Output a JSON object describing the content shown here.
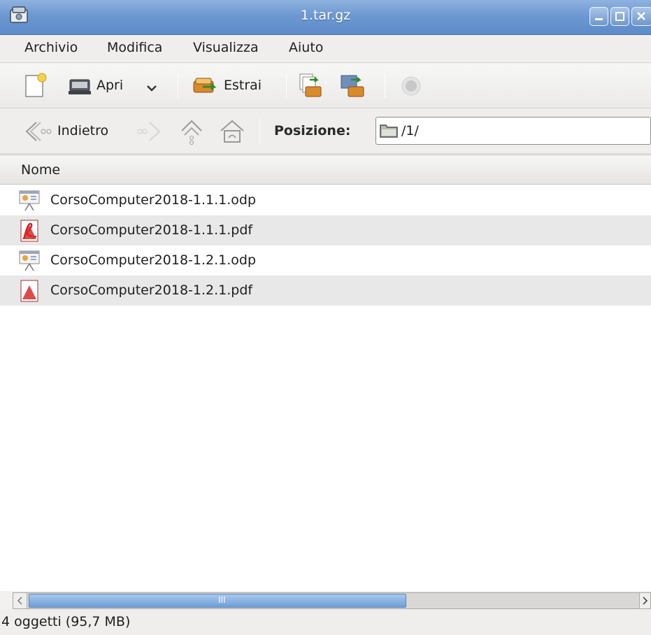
{
  "window": {
    "title": "1.tar.gz",
    "app_icon": "archive-manager-icon"
  },
  "menu": [
    "Archivio",
    "Modifica",
    "Visualizza",
    "Aiuto"
  ],
  "toolbar": {
    "new_icon": "new-archive-icon",
    "open_label": "Apri",
    "extract_label": "Estrai",
    "add_files_icon": "add-files-icon",
    "add_folder_icon": "add-folder-icon",
    "stop_icon": "stop-icon"
  },
  "location": {
    "back_label": "Indietro",
    "location_label": "Posizione:",
    "path": "/1/"
  },
  "list": {
    "column_name": "Nome",
    "files": [
      {
        "name": "CorsoComputer2018-1.1.1.odp",
        "icon": "presentation-icon"
      },
      {
        "name": "CorsoComputer2018-1.1.1.pdf",
        "icon": "pdf-icon"
      },
      {
        "name": "CorsoComputer2018-1.2.1.odp",
        "icon": "presentation-icon"
      },
      {
        "name": "CorsoComputer2018-1.2.1.pdf",
        "icon": "pdf-icon"
      }
    ]
  },
  "scrollbar": {
    "grip": "III"
  },
  "status": "4 oggetti (95,7 MB)",
  "colors": {
    "titlebar": "#6d98d1",
    "selection_alt_row": "#e8e8e8",
    "scroll_thumb": "#6f9fd6"
  }
}
